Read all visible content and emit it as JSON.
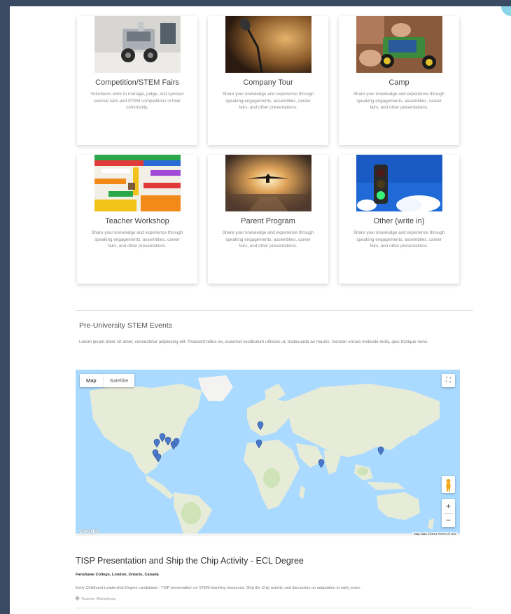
{
  "cards": [
    {
      "title": "Competition/STEM Fairs",
      "desc": "Volunteers work to manage, judge, and sponsor science fairs and STEM competitions in their community.",
      "image": "robot-kit-photo"
    },
    {
      "title": "Company Tour",
      "desc": "Share your knowledge and experience through speaking engagements, assemblies, career fairs, and other presentations.",
      "image": "microphone-photo"
    },
    {
      "title": "Camp",
      "desc": "Share your knowledge and experience through speaking engagements, assemblies, career fairs, and other presentations.",
      "image": "rc-car-photo"
    },
    {
      "title": "Teacher Workshop",
      "desc": "Share your knowledge and experience through speaking engagements, assemblies, career fairs, and other presentations.",
      "image": "colorful-maze-photo"
    },
    {
      "title": "Parent Program",
      "desc": "Share your knowledge and experience through speaking engagements, assemblies, career fairs, and other presentations.",
      "image": "airplane-sunset-photo"
    },
    {
      "title": "Other (write in)",
      "desc": "Share your knowledge and experience through speaking engagements, assemblies, career fairs, and other presentations.",
      "image": "traffic-light-photo"
    }
  ],
  "section": {
    "title": "Pre-University STEM Events",
    "desc": "Lorem ipsum dolor sit amet, consectetur adipiscing elit. Praesent tellus ex, euismod vestibulum ultricies ut, malesuada ac mauris. Aenean ornare molestie nulla, quis tristique nunc."
  },
  "map": {
    "map_label": "Map",
    "satellite_label": "Satellite",
    "fullscreen_glyph": "⛶",
    "zoom_in": "+",
    "zoom_out": "−",
    "logo": "Google",
    "attribution": "Map data ©2021   Terms of Use",
    "ocean_color": "#aadaff",
    "land_color": "#e7ecd9",
    "marker_color": "#4a78c9"
  },
  "event": {
    "title": "TISP Presentation and Ship the Chip Activity - ECL Degree",
    "location": "Fanshawe College, London, Ontario, Canada",
    "desc": "Early Childhood Leadership Degree candidates - TISP presentation on STEM teaching resources, Ship the Chip activity, and discussion on adaptation to early years.",
    "tag": "Teacher Workshops"
  }
}
